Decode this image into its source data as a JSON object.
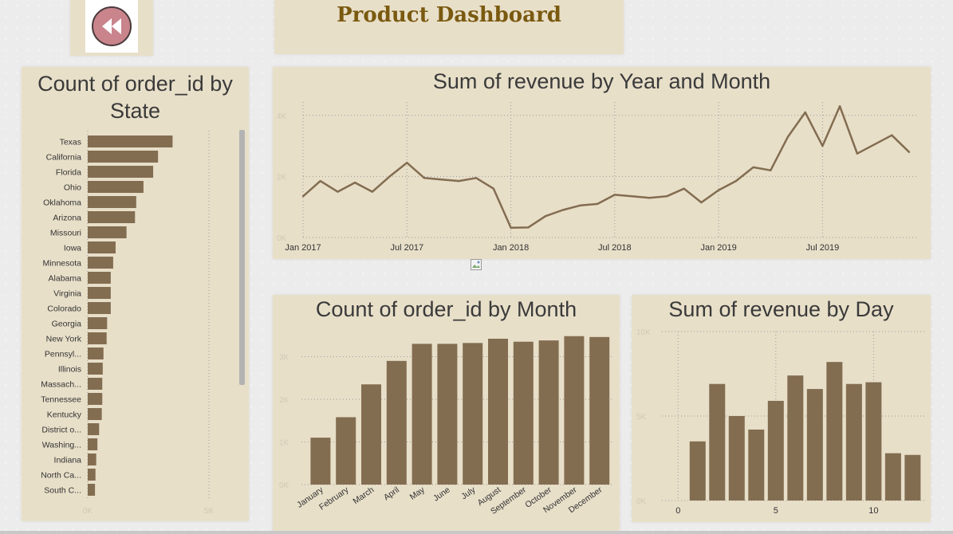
{
  "header": {
    "title": "Product Dashboard",
    "back_icon": "rewind-icon"
  },
  "colors": {
    "panel": "#e8dfc9",
    "bar": "#836d51",
    "title": "#7a5a10",
    "axis_text": "#d1c9b6"
  },
  "chart_data": [
    {
      "id": "state",
      "type": "bar",
      "orientation": "horizontal",
      "title": "Count of order_id by State",
      "categories": [
        "Texas",
        "California",
        "Florida",
        "Ohio",
        "Oklahoma",
        "Arizona",
        "Missouri",
        "Iowa",
        "Minnesota",
        "Alabama",
        "Virginia",
        "Colorado",
        "Georgia",
        "New York",
        "Pennsyl...",
        "Illinois",
        "Massach...",
        "Tennessee",
        "Kentucky",
        "District o...",
        "Washing...",
        "Indiana",
        "North Ca...",
        "South C..."
      ],
      "values": [
        3500,
        2900,
        2700,
        2300,
        2000,
        1950,
        1600,
        1150,
        1050,
        950,
        950,
        950,
        800,
        780,
        650,
        620,
        600,
        600,
        580,
        470,
        400,
        350,
        320,
        300
      ],
      "xticks": [
        "0K",
        "5K"
      ],
      "xlim": [
        0,
        5000
      ],
      "grid": true,
      "scrollbar": true
    },
    {
      "id": "revenue_month",
      "type": "line",
      "title": "Sum of revenue by Year and Month",
      "x": [
        "Jan 2017",
        "Feb 2017",
        "Mar 2017",
        "Apr 2017",
        "May 2017",
        "Jun 2017",
        "Jul 2017",
        "Aug 2017",
        "Sep 2017",
        "Oct 2017",
        "Nov 2017",
        "Dec 2017",
        "Jan 2018",
        "Feb 2018",
        "Mar 2018",
        "Apr 2018",
        "May 2018",
        "Jun 2018",
        "Jul 2018",
        "Aug 2018",
        "Sep 2018",
        "Oct 2018",
        "Nov 2018",
        "Dec 2018",
        "Jan 2019",
        "Feb 2019",
        "Mar 2019",
        "Apr 2019",
        "May 2019",
        "Jun 2019",
        "Jul 2019",
        "Aug 2019",
        "Sep 2019",
        "Oct 2019",
        "Nov 2019",
        "Dec 2019"
      ],
      "values": [
        1350,
        1850,
        1500,
        1800,
        1500,
        2000,
        2450,
        1950,
        1900,
        1850,
        1950,
        1600,
        320,
        330,
        700,
        900,
        1050,
        1100,
        1400,
        1350,
        1300,
        1350,
        1600,
        1150,
        1550,
        1850,
        2300,
        2200,
        3300,
        4100,
        3000,
        4300,
        2750,
        3050,
        3350,
        2800
      ],
      "xticks": [
        "Jan 2017",
        "Jul 2017",
        "Jan 2018",
        "Jul 2018",
        "Jan 2019",
        "Jul 2019"
      ],
      "yticks": [
        "0K",
        "2K",
        "4K"
      ],
      "ylim": [
        0,
        4700
      ],
      "grid": true
    },
    {
      "id": "order_month",
      "type": "bar",
      "title": "Count of order_id by Month",
      "categories": [
        "January",
        "February",
        "March",
        "April",
        "May",
        "June",
        "July",
        "August",
        "September",
        "October",
        "November",
        "December"
      ],
      "values": [
        1100,
        1580,
        2350,
        2900,
        3300,
        3300,
        3320,
        3420,
        3350,
        3380,
        3480,
        3460
      ],
      "yticks": [
        "0K",
        "1K",
        "2K",
        "3K"
      ],
      "ylim": [
        0,
        3700
      ],
      "grid": true
    },
    {
      "id": "revenue_day",
      "type": "bar",
      "title": "Sum of revenue by Day",
      "x": [
        1,
        2,
        3,
        4,
        5,
        6,
        7,
        8,
        9,
        10,
        11,
        12
      ],
      "values": [
        3500,
        6900,
        5000,
        4200,
        5900,
        7400,
        6600,
        8200,
        6900,
        7000,
        2800,
        2700
      ],
      "xticks": [
        "0",
        "5",
        "10"
      ],
      "yticks": [
        "0K",
        "5K",
        "10K"
      ],
      "xlim": [
        -0.5,
        12.8
      ],
      "ylim": [
        0,
        10000
      ],
      "grid": true
    }
  ]
}
